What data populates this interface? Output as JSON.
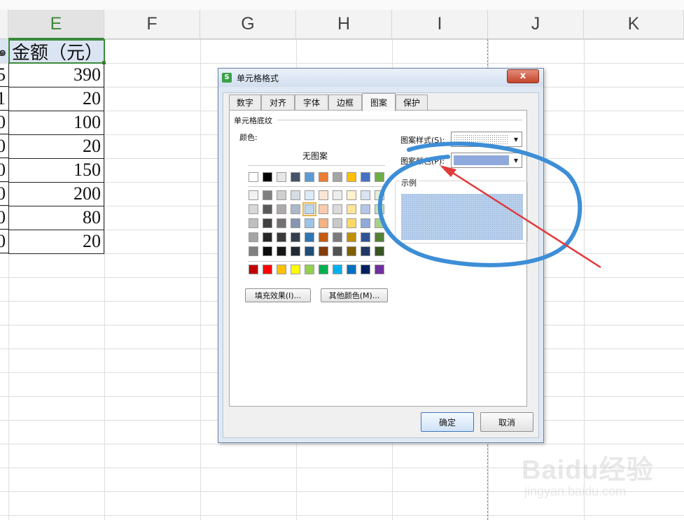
{
  "spreadsheet": {
    "columns": [
      "E",
      "F",
      "G",
      "H",
      "I",
      "J",
      "K"
    ],
    "selected_column": "E",
    "partial_left_col": [
      "",
      "5",
      "1",
      "0",
      "0",
      "0",
      "0",
      "0",
      "0"
    ],
    "partial_header_glyph": "๑",
    "header_cell": "金额（元）",
    "amounts": [
      "390",
      "20",
      "100",
      "20",
      "150",
      "200",
      "80",
      "20"
    ]
  },
  "dialog": {
    "title": "单元格格式",
    "close_label": "x",
    "tabs": [
      {
        "label": "数字",
        "active": false
      },
      {
        "label": "对齐",
        "active": false
      },
      {
        "label": "字体",
        "active": false
      },
      {
        "label": "边框",
        "active": false
      },
      {
        "label": "图案",
        "active": true
      },
      {
        "label": "保护",
        "active": false
      }
    ],
    "section_title": "单元格底纹",
    "color_label": "颜色:",
    "no_pattern_label": "无图案",
    "fill_effects_label": "填充效果(I)...",
    "more_colors_label": "其他颜色(M)...",
    "pattern_style_label": "图案样式(S):",
    "pattern_color_label": "图案颜色(P):",
    "pattern_color_value": "#8fa9dc",
    "sample_label": "示例",
    "ok_label": "确定",
    "cancel_label": "取消",
    "palette_top": [
      "#ffffff",
      "#000000",
      "#e7e6e6",
      "#44546a",
      "#5b9bd5",
      "#ed7d31",
      "#a5a5a5",
      "#ffc000",
      "#4472c4",
      "#70ad47"
    ],
    "palette_shades": [
      [
        "#f2f2f2",
        "#7f7f7f",
        "#d0cece",
        "#d6dce4",
        "#deebf6",
        "#fbe5d5",
        "#ededed",
        "#fff2cc",
        "#dae3f3",
        "#e2efd9"
      ],
      [
        "#d8d8d8",
        "#595959",
        "#aeaaaa",
        "#adb9ca",
        "#bdd7ee",
        "#f8cbad",
        "#dbdbdb",
        "#ffe598",
        "#b4c6e7",
        "#c5e0b3"
      ],
      [
        "#bfbfbf",
        "#3f3f3f",
        "#757070",
        "#8496b0",
        "#9dc3e6",
        "#f4b183",
        "#c9c9c9",
        "#ffd965",
        "#8eaadb",
        "#a8d08d"
      ],
      [
        "#a5a5a5",
        "#262626",
        "#3a3838",
        "#323f4f",
        "#2e75b5",
        "#c55a11",
        "#7b7b7b",
        "#bf9000",
        "#2f5496",
        "#538135"
      ],
      [
        "#7f7f7f",
        "#0c0c0c",
        "#171616",
        "#222a35",
        "#1f4e79",
        "#833c0b",
        "#525252",
        "#7f6000",
        "#203864",
        "#375623"
      ]
    ],
    "palette_standard": [
      "#c00000",
      "#ff0000",
      "#ffc000",
      "#ffff00",
      "#92d050",
      "#00b050",
      "#00b0f0",
      "#0070c0",
      "#002060",
      "#7030a0"
    ]
  },
  "watermark": {
    "brand": "Baidu经验",
    "url": "jingyan.baidu.com"
  }
}
